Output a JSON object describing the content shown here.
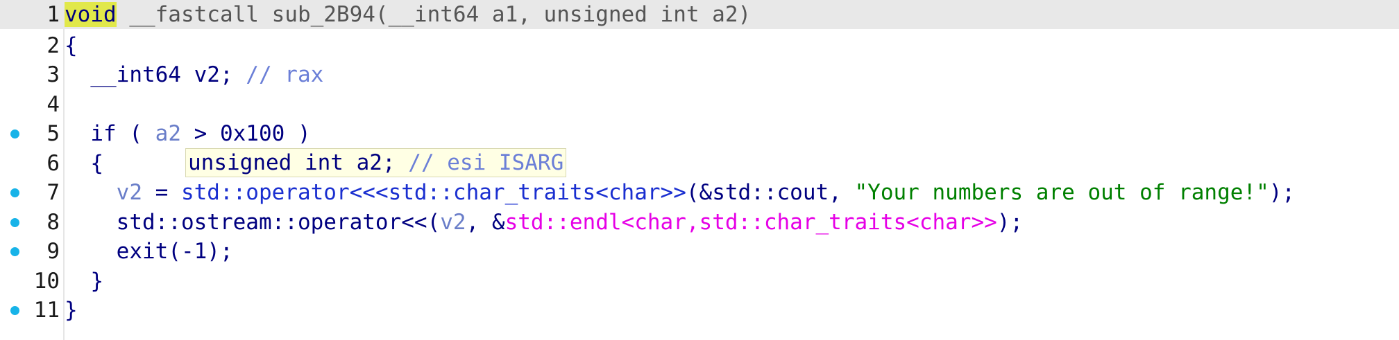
{
  "editor": {
    "lines": [
      {
        "n": "1",
        "bp": false,
        "tokens": [
          [
            "void",
            "kw hl-void"
          ],
          [
            " __fastcall sub_2B94(__int64 a1, unsigned int a2)",
            "gray"
          ]
        ]
      },
      {
        "n": "2",
        "bp": false,
        "tokens": [
          [
            "{",
            "pn"
          ]
        ]
      },
      {
        "n": "3",
        "bp": false,
        "tokens": [
          [
            "  __int64 v2; ",
            "kw"
          ],
          [
            "// rax",
            "cm"
          ]
        ]
      },
      {
        "n": "4",
        "bp": false,
        "tokens": []
      },
      {
        "n": "5",
        "bp": true,
        "tokens": [
          [
            "  if ( ",
            "kw"
          ],
          [
            "a2",
            "var"
          ],
          [
            " > 0x100 )",
            "pn"
          ]
        ]
      },
      {
        "n": "6",
        "bp": false,
        "tokens": [
          [
            "  {",
            "pn"
          ]
        ]
      },
      {
        "n": "7",
        "bp": true,
        "tokens": [
          [
            "    ",
            "pn"
          ],
          [
            "v2",
            "var"
          ],
          [
            " = ",
            "pn"
          ],
          [
            "std::operator<<<std::char_traits<char>>",
            "fn"
          ],
          [
            "(&std::cout, ",
            "id"
          ],
          [
            "\"Your numbers are out of range!\"",
            "str"
          ],
          [
            ");",
            "pn"
          ]
        ]
      },
      {
        "n": "8",
        "bp": true,
        "tokens": [
          [
            "    std::ostream::operator<<(",
            "id"
          ],
          [
            "v2",
            "var"
          ],
          [
            ", &",
            "pn"
          ],
          [
            "std::endl<char,std::char_traits<char>>",
            "imp"
          ],
          [
            ");",
            "pn"
          ]
        ]
      },
      {
        "n": "9",
        "bp": true,
        "tokens": [
          [
            "    exit(-1);",
            "id"
          ]
        ]
      },
      {
        "n": "10",
        "bp": false,
        "tokens": [
          [
            "  }",
            "pn"
          ]
        ]
      },
      {
        "n": "11",
        "bp": true,
        "tokens": [
          [
            "}",
            "pn"
          ]
        ]
      }
    ],
    "current_line": "1"
  },
  "tooltip": {
    "decl": "unsigned int a2; ",
    "comment": "// esi ISARG"
  },
  "colors": {
    "breakpoint": "#17b3e8",
    "keyword": "#00007f",
    "comment": "#6b7fd7",
    "string": "#008000",
    "import": "#e600e6",
    "highlight": "#e1e84a"
  }
}
